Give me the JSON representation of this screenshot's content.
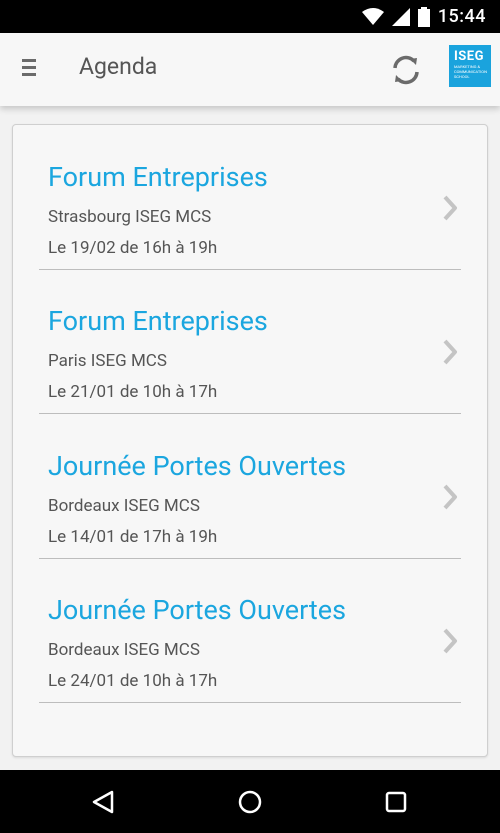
{
  "status_bar": {
    "time": "15:44",
    "icons": [
      "wifi-icon",
      "signal-icon",
      "battery-icon"
    ]
  },
  "app_bar": {
    "title": "Agenda",
    "menu_icon": "hamburger-menu-icon",
    "refresh_icon": "refresh-icon",
    "logo_text": "ISEG",
    "logo_subtext": "MARKETING & COMMUNICATION SCHOOL"
  },
  "events": [
    {
      "title": "Forum Entreprises",
      "location": "Strasbourg ISEG MCS",
      "date": "Le 19/02 de 16h à 19h"
    },
    {
      "title": "Forum Entreprises",
      "location": "Paris ISEG MCS",
      "date": "Le 21/01 de 10h à 17h"
    },
    {
      "title": "Journée Portes Ouvertes",
      "location": "Bordeaux ISEG MCS",
      "date": "Le 14/01 de 17h à 19h"
    },
    {
      "title": "Journée Portes Ouvertes",
      "location": "Bordeaux ISEG MCS",
      "date": "Le 24/01 de 10h à 17h"
    }
  ],
  "nav_bar": {
    "buttons": [
      "back-icon",
      "home-icon",
      "recents-icon"
    ]
  },
  "colors": {
    "accent": "#1ba6df",
    "logo_bg": "#1aa3dd",
    "text_secondary": "#555555"
  }
}
